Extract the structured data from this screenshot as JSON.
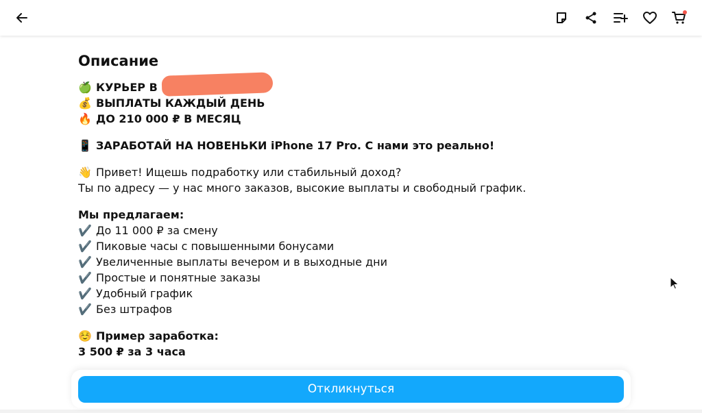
{
  "header": {
    "icons": [
      "arrow-left-icon",
      "note-icon",
      "share-icon",
      "compare-list-icon",
      "heart-icon",
      "cart-icon"
    ]
  },
  "description": {
    "title": "Описание",
    "lines": [
      {
        "emoji": "🍏",
        "text": "КУРЬЕР В",
        "bold": true
      },
      {
        "emoji": "💰",
        "text": "ВЫПЛАТЫ КАЖДЫЙ ДЕНЬ",
        "bold": true
      },
      {
        "emoji": "🔥",
        "text": "ДО 210 000 ₽ В МЕСЯЦ",
        "bold": true
      },
      {
        "emoji": "📱",
        "text": "ЗАРАБОТАЙ НА НОВЕНЬКИ iPhone 17 Pro. С нами это реально!",
        "bold": true
      },
      {
        "emoji": "👋",
        "text": "Привет! Ищешь подработку или стабильный доход?",
        "bold": false
      },
      {
        "emoji": "",
        "text": "Ты по адресу — у нас много заказов, высокие выплаты и свободный график.",
        "bold": false
      },
      {
        "emoji": "",
        "text": "Мы предлагаем:",
        "bold": true
      },
      {
        "emoji": "✔️",
        "text": "До 11 000 ₽ за смену",
        "bold": false
      },
      {
        "emoji": "✔️",
        "text": "Пиковые часы с повышенными бонусами",
        "bold": false
      },
      {
        "emoji": "✔️",
        "text": "Увеличенные выплаты вечером и в выходные дни",
        "bold": false
      },
      {
        "emoji": "✔️",
        "text": "Простые и понятные заказы",
        "bold": false
      },
      {
        "emoji": "✔️",
        "text": "Удобный график",
        "bold": false
      },
      {
        "emoji": "✔️",
        "text": "Без штрафов",
        "bold": false
      },
      {
        "emoji": "☺️",
        "text": "Пример заработка:",
        "bold": true
      },
      {
        "emoji": "",
        "text": "3 500 ₽ за 3 часа",
        "bold": true
      }
    ]
  },
  "cta": {
    "label": "Откликнуться",
    "color": "#13a8fc"
  },
  "colors": {
    "accent": "#13a8fc",
    "cart_badge": "#f4564c",
    "redaction": "#f77a5a"
  }
}
